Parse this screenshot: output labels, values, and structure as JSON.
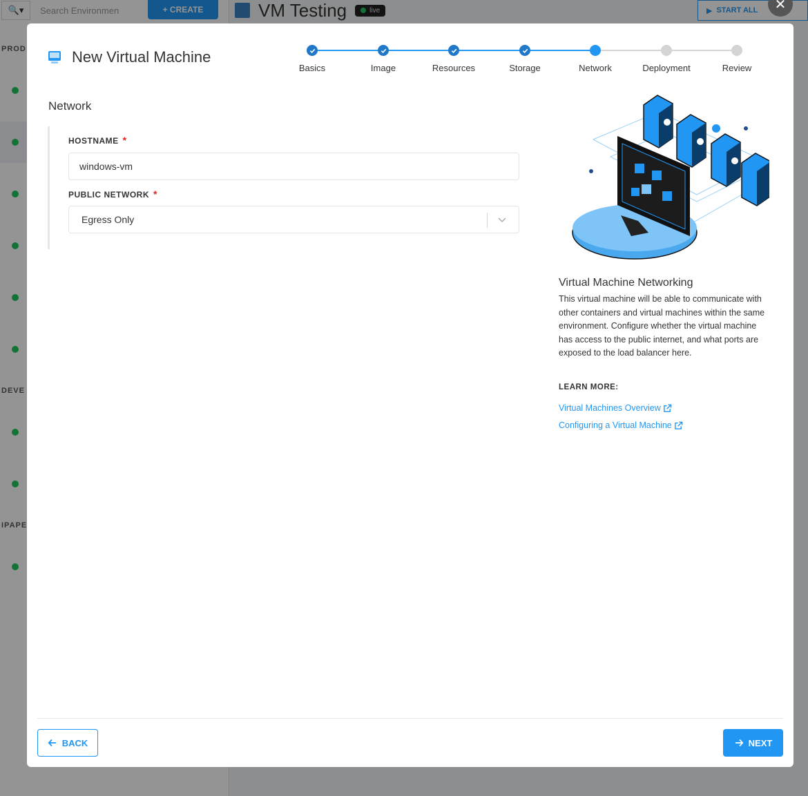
{
  "background": {
    "search_placeholder": "Search Environmen",
    "create_label": "+ CREATE",
    "group_labels": [
      "PROD",
      "DEVE",
      "IPAPE"
    ],
    "env_title": "VM Testing",
    "env_badge": "live",
    "start_all_label": "START ALL"
  },
  "modal": {
    "title": "New Virtual Machine",
    "icon": "computer-icon",
    "close_icon": "close-icon"
  },
  "stepper": {
    "steps": [
      {
        "label": "Basics",
        "state": "done"
      },
      {
        "label": "Image",
        "state": "done"
      },
      {
        "label": "Resources",
        "state": "done"
      },
      {
        "label": "Storage",
        "state": "done"
      },
      {
        "label": "Network",
        "state": "current"
      },
      {
        "label": "Deployment",
        "state": "future"
      },
      {
        "label": "Review",
        "state": "future"
      }
    ]
  },
  "form": {
    "section_title": "Network",
    "hostname": {
      "label": "HOSTNAME",
      "required_mark": "*",
      "value": "windows-vm"
    },
    "public_network": {
      "label": "PUBLIC NETWORK",
      "required_mark": "*",
      "value": "Egress Only"
    }
  },
  "info": {
    "title": "Virtual Machine Networking",
    "text": "This virtual machine will be able to communicate with other containers and virtual machines within the same environment. Configure whether the virtual machine has access to the public internet, and what ports are exposed to the load balancer here.",
    "learn_more": "LEARN MORE:",
    "links": [
      {
        "label": "Virtual Machines Overview"
      },
      {
        "label": "Configuring a Virtual Machine"
      }
    ]
  },
  "footer": {
    "back_label": "BACK",
    "next_label": "NEXT"
  },
  "colors": {
    "accent": "#2196f3",
    "step_done": "#1f78c8",
    "step_future": "#d4d4d4",
    "required": "#e02424"
  }
}
